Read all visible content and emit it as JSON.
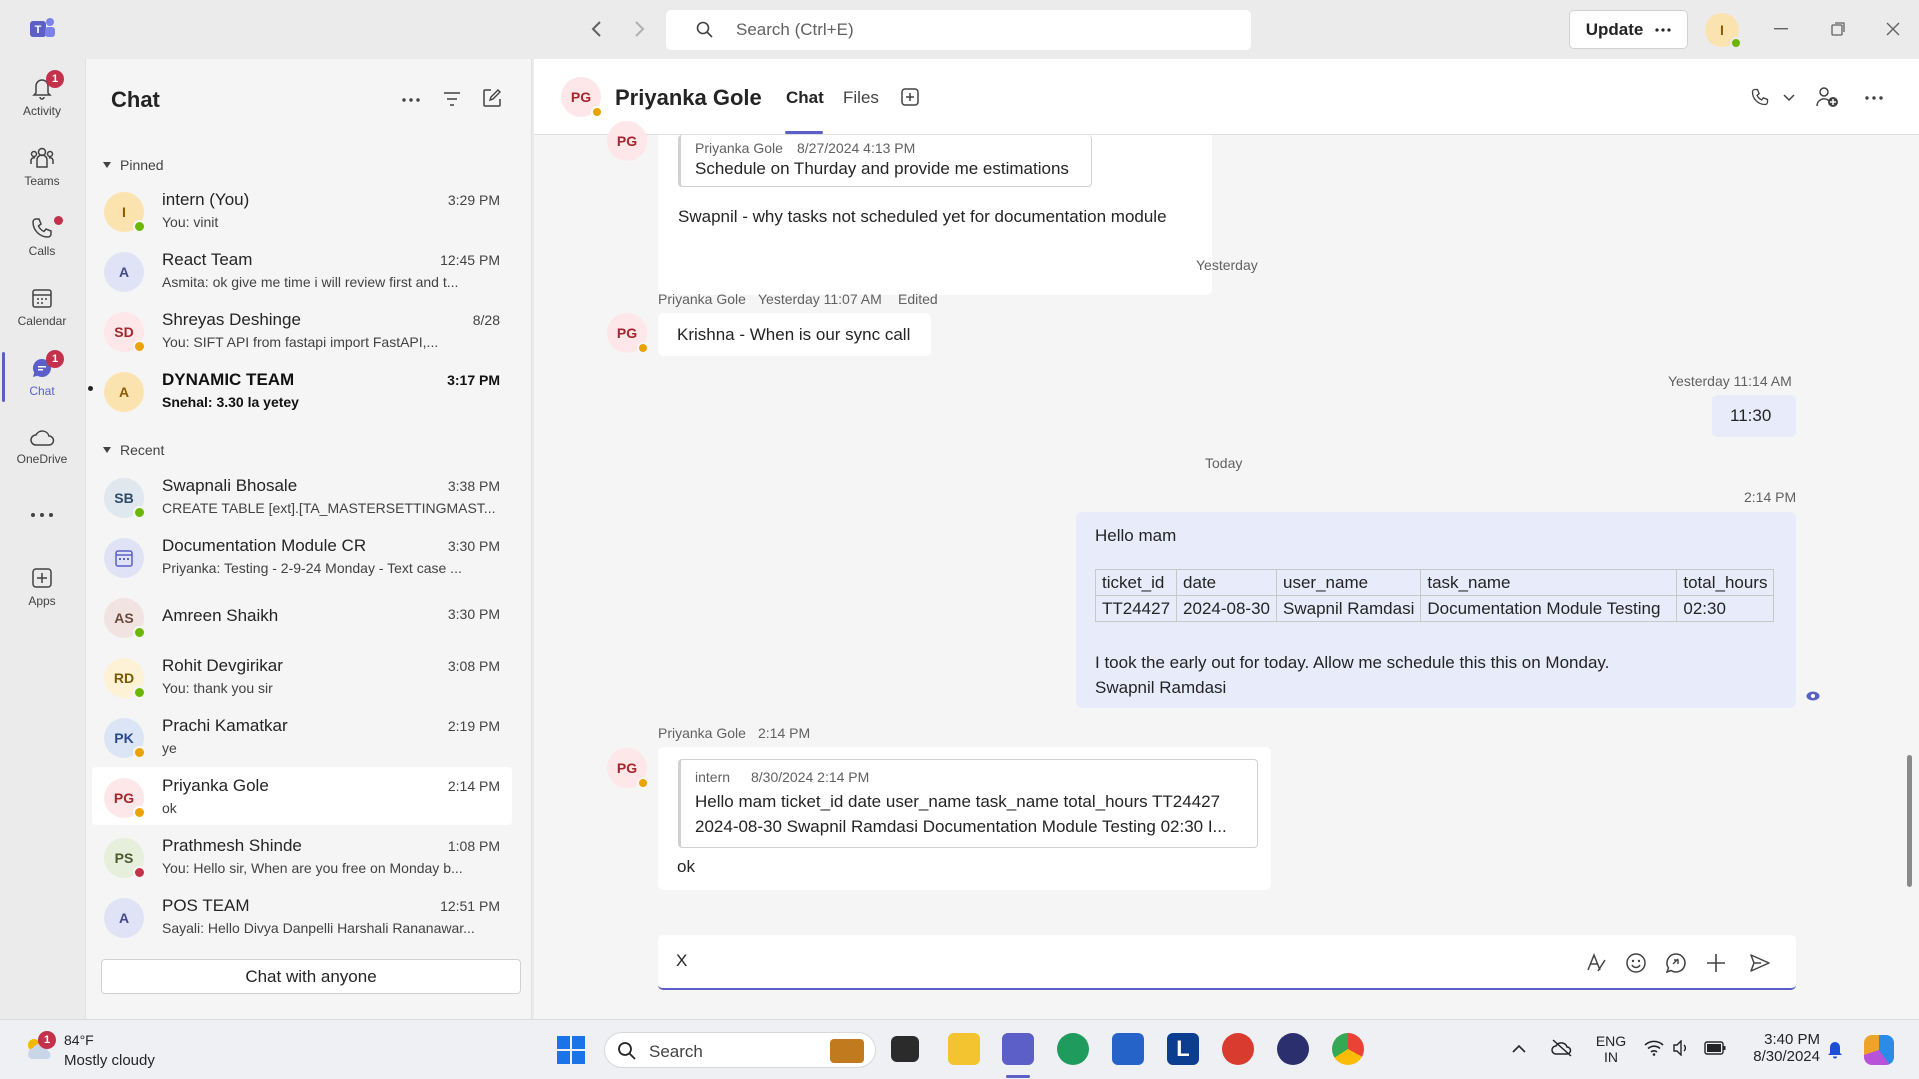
{
  "titlebar": {
    "search_placeholder": "Search (Ctrl+E)",
    "update_label": "Update",
    "user_initial": "I"
  },
  "rail": {
    "items": [
      {
        "label": "Activity",
        "badge": "1"
      },
      {
        "label": "Teams"
      },
      {
        "label": "Calls"
      },
      {
        "label": "Calendar"
      },
      {
        "label": "Chat",
        "badge": "1"
      },
      {
        "label": "OneDrive"
      },
      {
        "label": "Apps"
      }
    ]
  },
  "chatlist": {
    "title": "Chat",
    "pinned_label": "Pinned",
    "recent_label": "Recent",
    "pinned": [
      {
        "initials": "I",
        "name": "intern (You)",
        "preview": "You: vinit",
        "time": "3:29 PM"
      },
      {
        "initials": "A",
        "name": "React Team",
        "preview": "Asmita: ok give me time i will review first and t...",
        "time": "12:45 PM"
      },
      {
        "initials": "SD",
        "name": "Shreyas Deshinge",
        "preview": "You: SIFT API          from fastapi import FastAPI,...",
        "time": "8/28"
      },
      {
        "initials": "A",
        "name": "DYNAMIC TEAM",
        "preview": "Snehal: 3.30 la yetey",
        "time": "3:17 PM"
      }
    ],
    "recent": [
      {
        "initials": "SB",
        "name": "Swapnali Bhosale",
        "preview": "CREATE TABLE [ext].[TA_MASTERSETTINGMAST...",
        "time": "3:38 PM"
      },
      {
        "initials": "",
        "name": "Documentation Module CR",
        "preview": "Priyanka: Testing - 2-9-24  Monday - Text case ...",
        "time": "3:30 PM"
      },
      {
        "initials": "AS",
        "name": "Amreen Shaikh",
        "preview": "",
        "time": "3:30 PM"
      },
      {
        "initials": "RD",
        "name": "Rohit Devgirikar",
        "preview": "You: thank you sir",
        "time": "3:08 PM"
      },
      {
        "initials": "PK",
        "name": "Prachi Kamatkar",
        "preview": "ye",
        "time": "2:19 PM"
      },
      {
        "initials": "PG",
        "name": "Priyanka Gole",
        "preview": "ok",
        "time": "2:14 PM"
      },
      {
        "initials": "PS",
        "name": "Prathmesh Shinde",
        "preview": "You: Hello sir, When are you free on Monday b...",
        "time": "1:08 PM"
      },
      {
        "initials": "A",
        "name": "POS TEAM",
        "preview": "Sayali: Hello Divya Danpelli Harshali Rananawar...",
        "time": "12:51 PM"
      }
    ],
    "chat_anyone_label": "Chat with anyone"
  },
  "header": {
    "initials": "PG",
    "name": "Priyanka Gole",
    "tabs": [
      "Chat",
      "Files"
    ]
  },
  "messages": {
    "quote1_author": "Priyanka Gole",
    "quote1_time": "8/27/2024 4:13 PM",
    "quote1_text": "Schedule on Thurday and provide me estimations",
    "msg1_text": "Swapnil - why tasks not scheduled yet for documentation module",
    "divider_yesterday": "Yesterday",
    "msg2_author": "Priyanka Gole",
    "msg2_time": "Yesterday 11:07 AM",
    "msg2_edited": "Edited",
    "msg2_text": "Krishna - When is our sync call",
    "msg3_time": "Yesterday 11:14 AM",
    "msg3_text": "11:30",
    "divider_today": "Today",
    "msg4_time": "2:14 PM",
    "msg4_greeting": "Hello mam",
    "table": {
      "headers": [
        "ticket_id",
        "date",
        "user_name",
        "task_name",
        "total_hours"
      ],
      "row": [
        "TT24427",
        "2024-08-30",
        "Swapnil Ramdasi",
        "Documentation Module Testing",
        "02:30"
      ]
    },
    "msg4_line1": "I took the early out for today. Allow me schedule this this on Monday.",
    "msg4_line2": "Swapnil Ramdasi",
    "msg5_author": "Priyanka Gole",
    "msg5_time": "2:14 PM",
    "quote2_author": "intern",
    "quote2_time": "8/30/2024 2:14 PM",
    "quote2_line1": "Hello mam ticket_id date user_name task_name total_hours TT24427",
    "quote2_line2": "2024-08-30 Swapnil Ramdasi Documentation Module Testing 02:30 I...",
    "msg5_text": "ok"
  },
  "composer": {
    "value": "X"
  },
  "taskbar": {
    "weather_temp": "84°F",
    "weather_desc": "Mostly cloudy",
    "weather_badge": "1",
    "search_label": "Search",
    "lang_line1": "ENG",
    "lang_line2": "IN",
    "clock_time": "3:40 PM",
    "clock_date": "8/30/2024"
  }
}
